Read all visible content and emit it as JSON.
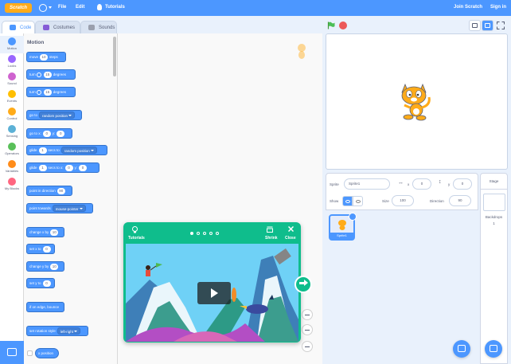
{
  "menubar": {
    "logo_text": "Scratch",
    "file": "File",
    "edit": "Edit",
    "tutorials": "Tutorials",
    "join": "Join Scratch",
    "signin": "Sign in"
  },
  "tabs": {
    "code": "Code",
    "costumes": "Costumes",
    "sounds": "Sounds"
  },
  "categories": [
    {
      "label": "Motion",
      "color": "#4c97ff"
    },
    {
      "label": "Looks",
      "color": "#9966ff"
    },
    {
      "label": "Sound",
      "color": "#cf63cf"
    },
    {
      "label": "Events",
      "color": "#ffbf00"
    },
    {
      "label": "Control",
      "color": "#ffab19"
    },
    {
      "label": "Sensing",
      "color": "#5cb1d6"
    },
    {
      "label": "Operators",
      "color": "#59c059"
    },
    {
      "label": "Variables",
      "color": "#ff8c1a"
    },
    {
      "label": "My Blocks",
      "color": "#ff6680"
    }
  ],
  "palette": {
    "title": "Motion",
    "move": {
      "a": "move",
      "v": "10",
      "b": "steps"
    },
    "turn_right": {
      "a": "turn",
      "v": "15",
      "b": "degrees"
    },
    "turn_left": {
      "a": "turn",
      "v": "15",
      "b": "degrees"
    },
    "goto": {
      "a": "go to",
      "dd": "random position"
    },
    "goto_xy": {
      "a": "go to x:",
      "x": "0",
      "b": "y:",
      "y": "0"
    },
    "glide_to": {
      "a": "glide",
      "v": "1",
      "b": "secs to",
      "dd": "random position"
    },
    "glide_xy": {
      "a": "glide",
      "v": "1",
      "b": "secs to x:",
      "x": "0",
      "c": "y:",
      "y": "0"
    },
    "point_dir": {
      "a": "point in direction",
      "v": "90"
    },
    "point_towards": {
      "a": "point towards",
      "dd": "mouse-pointer"
    },
    "change_x": {
      "a": "change x by",
      "v": "10"
    },
    "set_x": {
      "a": "set x to",
      "v": "0"
    },
    "change_y": {
      "a": "change y by",
      "v": "10"
    },
    "set_y": {
      "a": "set y to",
      "v": "0"
    },
    "bounce": "if on edge, bounce",
    "rotation": {
      "a": "set rotation style",
      "dd": "left-right"
    },
    "xpos": "x position"
  },
  "tutorial": {
    "tutorials_label": "Tutorials",
    "shrink": "Shrink",
    "close": "Close",
    "pages": 5,
    "current_page": 1
  },
  "sprite_info": {
    "sprite_label": "Sprite",
    "sprite_name": "Sprite1",
    "x_label": "x",
    "x": "0",
    "y_label": "y",
    "y": "0",
    "show_label": "Show",
    "size_label": "Size",
    "size": "100",
    "direction_label": "Direction",
    "direction": "90"
  },
  "sprites": [
    {
      "name": "Sprite1"
    }
  ],
  "stage_pane": {
    "header": "Stage",
    "backdrops_label": "Backdrops",
    "backdrops_count": "1"
  },
  "colors": {
    "accent": "#4c97ff",
    "tutorial": "#0fbd8c",
    "stop": "#ec5959"
  }
}
